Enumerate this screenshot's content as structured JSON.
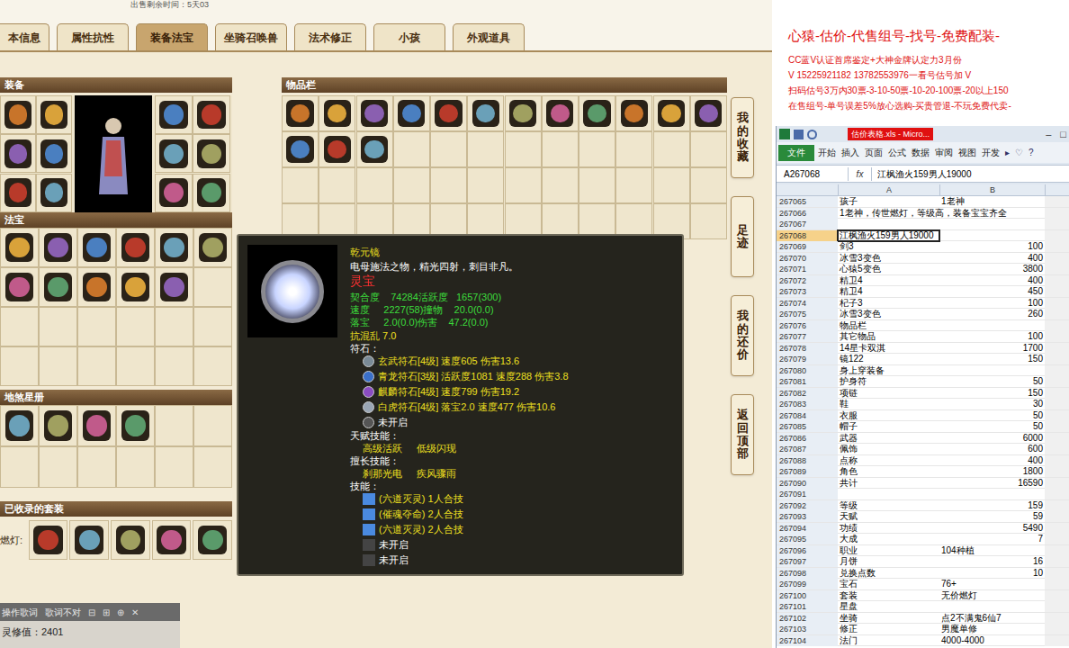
{
  "page": {
    "top_note": "出售剩余时间：5天03",
    "tabs": [
      {
        "label": "本信息",
        "selected": false
      },
      {
        "label": "属性抗性",
        "selected": false
      },
      {
        "label": "装备法宝",
        "selected": true
      },
      {
        "label": "坐骑召唤兽",
        "selected": false
      },
      {
        "label": "法术修正",
        "selected": false
      },
      {
        "label": "小孩",
        "selected": false
      },
      {
        "label": "外观道具",
        "selected": false
      }
    ]
  },
  "equipment": {
    "title": "装备",
    "left_slots": [
      true,
      true,
      true,
      true,
      true,
      true
    ],
    "right_slots": [
      true,
      true,
      true,
      true,
      true,
      true
    ]
  },
  "fabao": {
    "title": "法宝",
    "slots": [
      true,
      true,
      true,
      true,
      true,
      true,
      true,
      true,
      true,
      true,
      true,
      false,
      false,
      false,
      false,
      false,
      false,
      false,
      false,
      false,
      false,
      false,
      false,
      false
    ]
  },
  "disha": {
    "title": "地煞星册",
    "slots": [
      true,
      true,
      true,
      true,
      false,
      false,
      false,
      false,
      false,
      false,
      false,
      false
    ]
  },
  "suits": {
    "title": "已收录的套装",
    "label": "燃灯:",
    "slots": [
      true,
      true,
      true,
      true,
      true
    ]
  },
  "inventory": {
    "title": "物品栏",
    "slots": [
      true,
      true,
      true,
      true,
      true,
      true,
      true,
      true,
      true,
      true,
      true,
      true,
      true,
      true,
      true,
      false,
      false,
      false,
      false,
      false,
      false,
      false,
      false,
      false,
      false,
      false,
      false,
      false,
      false,
      false,
      false,
      false,
      false,
      false,
      false,
      false,
      false,
      false,
      false,
      false,
      false,
      false,
      false,
      false,
      false,
      false,
      false,
      false
    ]
  },
  "side_buttons": [
    "我的收藏",
    "足迹",
    "我的还价",
    "返回顶部"
  ],
  "tooltip": {
    "name": "乾元镜",
    "desc": "电母施法之物，精光四射，刺目非凡。",
    "seal": "灵宝",
    "stats": [
      "契合度    74284活跃度   1657(300)",
      "速度     2227(58)撞物    20.0(0.0)",
      "落宝     2.0(0.0)伤害    47.2(0.0)"
    ],
    "resist": "抗混乱 7.0",
    "runes_title": "符石：",
    "runes": [
      {
        "name": "玄武符石[4级] 速度605 伤害13.6",
        "open": true,
        "color": "#7a8a96"
      },
      {
        "name": "青龙符石[3级] 活跃度1081 速度288 伤害3.8",
        "open": true,
        "color": "#3a6fc8"
      },
      {
        "name": "麒麟符石[4级] 速度799 伤害19.2",
        "open": true,
        "color": "#8a4cc0"
      },
      {
        "name": "白虎符石[4级] 落宝2.0 速度477 伤害10.6",
        "open": true,
        "color": "#9aa6b4"
      },
      {
        "name": "未开启",
        "open": false,
        "color": "#555555"
      }
    ],
    "talent_title": "天赋技能：",
    "talents": [
      "高级活跃",
      "低级闪现"
    ],
    "special_title": "擅长技能：",
    "specials": [
      "刹那光电",
      "疾风骤雨"
    ],
    "skills_title": "技能：",
    "skills": [
      {
        "name": "(六道灭灵) 1人合技",
        "open": true
      },
      {
        "name": "(催魂夺命) 2人合技",
        "open": true
      },
      {
        "name": "(六道灭灵) 2人合技",
        "open": true
      },
      {
        "name": "未开启",
        "open": false
      },
      {
        "name": "未开启",
        "open": false
      }
    ]
  },
  "player_bar": {
    "buttons": [
      "操作歌词",
      "歌词不对"
    ],
    "glyphs": [
      "⊟",
      "⊞",
      "⊕",
      "✕"
    ],
    "lingxiu": "灵修值：2401"
  },
  "ad": {
    "lines": [
      "心猿-估价-代售组号-找号-免费配装-",
      "CC蓝V认证首席鉴定+大神金牌认定力3月份",
      "V 15225921182  13782553976一看号估号加 V",
      "扫码估号3万内30票-3-10-50票-10-20-100票-20以上150",
      "在售组号-单号误差5%放心选购-买贵管退-不玩免费代卖-"
    ]
  },
  "excel": {
    "title": "估价表格.xls - Micro...",
    "window_buttons": [
      "–",
      "□"
    ],
    "ribbon_tabs": [
      {
        "label": "文件",
        "selected": true
      },
      {
        "label": "开始",
        "selected": false
      },
      {
        "label": "插入",
        "selected": false
      },
      {
        "label": "页面",
        "selected": false
      },
      {
        "label": "公式",
        "selected": false
      },
      {
        "label": "数据",
        "selected": false
      },
      {
        "label": "审阅",
        "selected": false
      },
      {
        "label": "视图",
        "selected": false
      },
      {
        "label": "开发",
        "selected": false
      }
    ],
    "ribbon_glyphs": [
      "▸",
      "♡",
      "?"
    ],
    "name_box": "A267068",
    "fx": "fx",
    "formula": "江枫渔火159男人19000",
    "columns": [
      "A",
      "B"
    ],
    "rows": [
      {
        "num": "267065",
        "a": "孩子",
        "b": "1老神",
        "selected": false
      },
      {
        "num": "267066",
        "a": "1老神，传世燃灯，等级高，装备宝宝齐全",
        "b": "",
        "selected": false
      },
      {
        "num": "267067",
        "a": "",
        "b": "",
        "selected": false
      },
      {
        "num": "267068",
        "a": "江枫渔火159男人19000",
        "b": "",
        "selected": true
      },
      {
        "num": "267069",
        "a": "剑3",
        "b": "100",
        "selected": false
      },
      {
        "num": "267070",
        "a": "冰雪3变色",
        "b": "400",
        "selected": false
      },
      {
        "num": "267071",
        "a": "心猿5变色",
        "b": "3800",
        "selected": false
      },
      {
        "num": "267072",
        "a": "精卫4",
        "b": "400",
        "selected": false
      },
      {
        "num": "267073",
        "a": "精卫4",
        "b": "450",
        "selected": false
      },
      {
        "num": "267074",
        "a": "杞子3",
        "b": "100",
        "selected": false
      },
      {
        "num": "267075",
        "a": "冰雪3变色",
        "b": "260",
        "selected": false
      },
      {
        "num": "267076",
        "a": "物品栏",
        "b": "",
        "selected": false
      },
      {
        "num": "267077",
        "a": "其它物品",
        "b": "100",
        "selected": false
      },
      {
        "num": "267078",
        "a": "14星卡双淇",
        "b": "1700",
        "selected": false
      },
      {
        "num": "267079",
        "a": "镜122",
        "b": "150",
        "selected": false
      },
      {
        "num": "267080",
        "a": "身上穿装备",
        "b": "",
        "selected": false
      },
      {
        "num": "267081",
        "a": "护身符",
        "b": "50",
        "selected": false
      },
      {
        "num": "267082",
        "a": "项链",
        "b": "150",
        "selected": false
      },
      {
        "num": "267083",
        "a": "鞋",
        "b": "30",
        "selected": false
      },
      {
        "num": "267084",
        "a": "衣服",
        "b": "50",
        "selected": false
      },
      {
        "num": "267085",
        "a": "帽子",
        "b": "50",
        "selected": false
      },
      {
        "num": "267086",
        "a": "武器",
        "b": "6000",
        "selected": false
      },
      {
        "num": "267087",
        "a": "佩饰",
        "b": "600",
        "selected": false
      },
      {
        "num": "267088",
        "a": "点称",
        "b": "400",
        "selected": false
      },
      {
        "num": "267089",
        "a": "角色",
        "b": "1800",
        "selected": false
      },
      {
        "num": "267090",
        "a": "共计",
        "b": "16590",
        "selected": false
      },
      {
        "num": "267091",
        "a": "",
        "b": "",
        "selected": false
      },
      {
        "num": "267092",
        "a": "等级",
        "b": "159",
        "selected": false
      },
      {
        "num": "267093",
        "a": "天赋",
        "b": "59",
        "selected": false
      },
      {
        "num": "267094",
        "a": "功绩",
        "b": "5490",
        "selected": false
      },
      {
        "num": "267095",
        "a": "大成",
        "b": "7",
        "selected": false
      },
      {
        "num": "267096",
        "a": "职业",
        "b": "104种植",
        "selected": false
      },
      {
        "num": "267097",
        "a": "月饼",
        "b": "16",
        "selected": false
      },
      {
        "num": "267098",
        "a": "兑换点数",
        "b": "10",
        "selected": false
      },
      {
        "num": "267099",
        "a": "宝石",
        "b": "76+",
        "selected": false
      },
      {
        "num": "267100",
        "a": "套装",
        "b": "无价燃灯",
        "selected": false
      },
      {
        "num": "267101",
        "a": "星盘",
        "b": "",
        "selected": false
      },
      {
        "num": "267102",
        "a": "坐骑",
        "b": "点2不满鬼6仙7",
        "selected": false
      },
      {
        "num": "267103",
        "a": "修正",
        "b": "男魔单修",
        "selected": false
      },
      {
        "num": "267104",
        "a": "法门",
        "b": "4000-4000",
        "selected": false
      }
    ]
  }
}
